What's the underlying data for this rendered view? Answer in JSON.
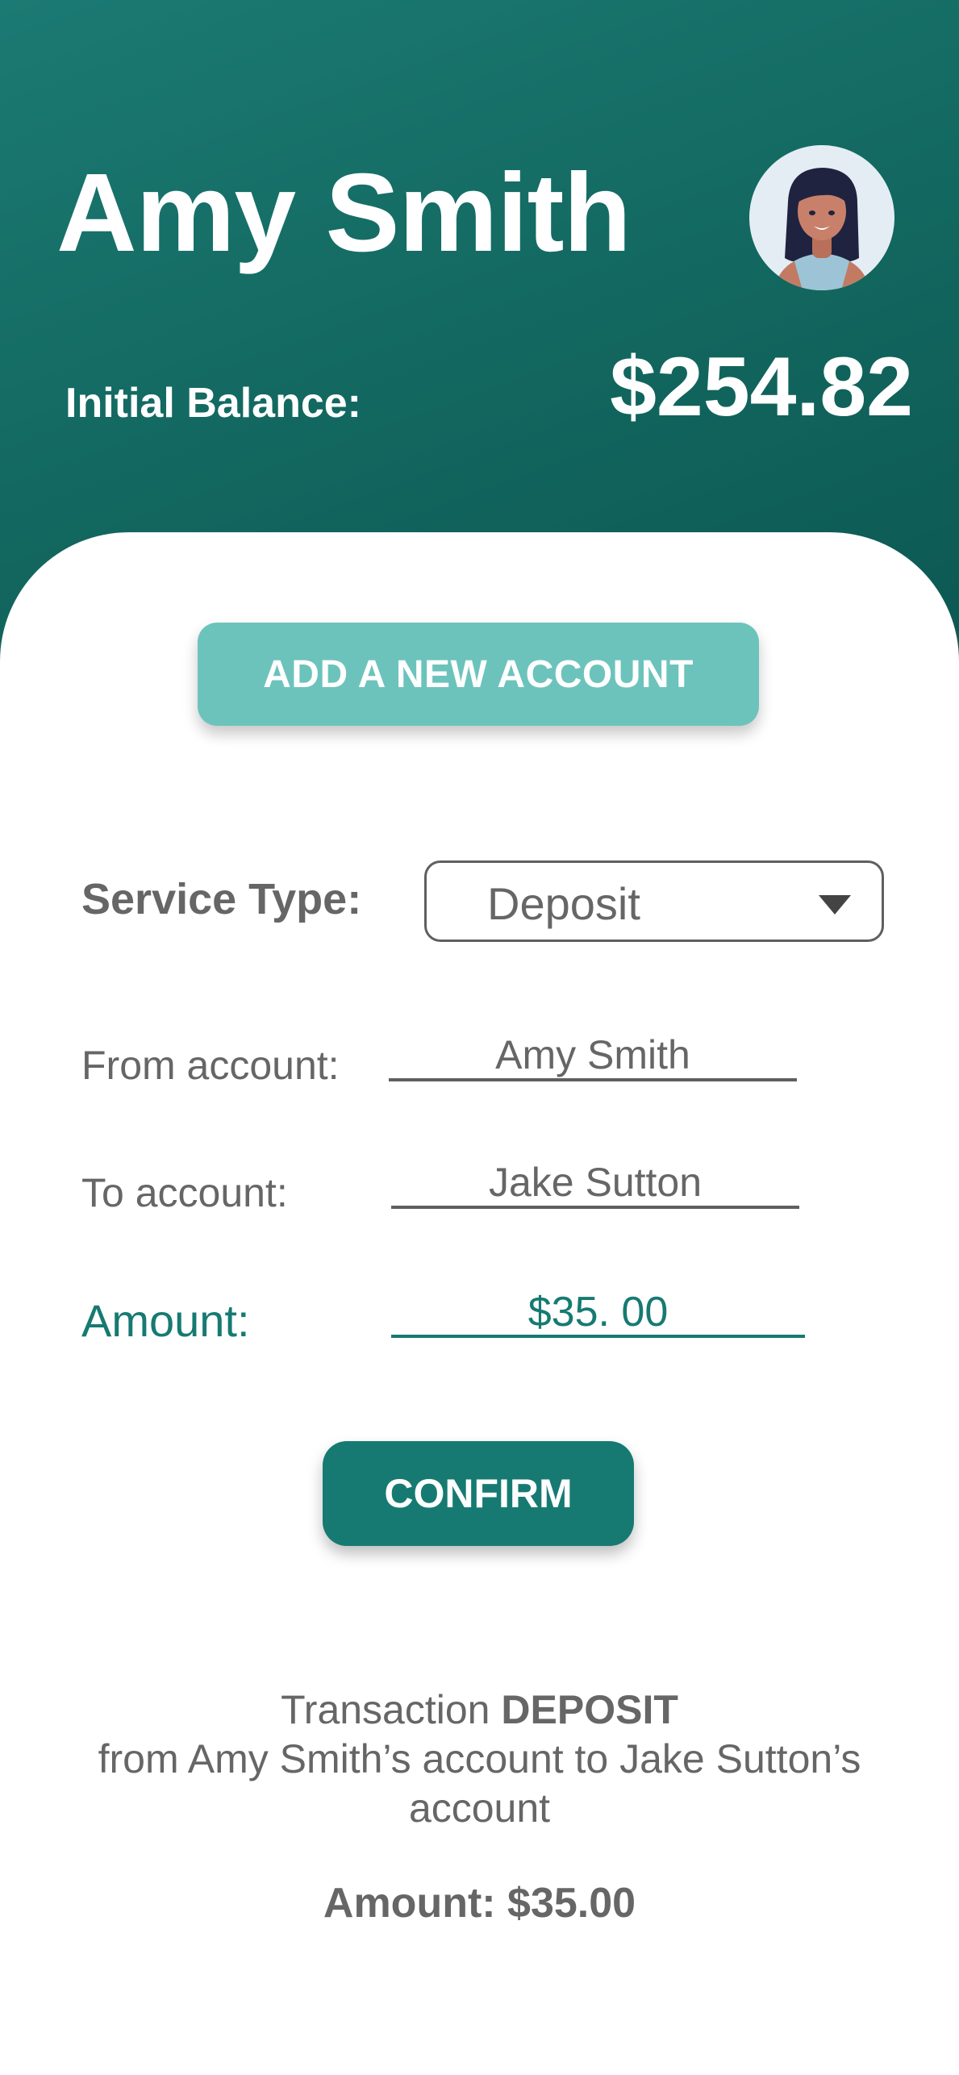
{
  "header": {
    "user_name": "Amy Smith",
    "balance_label": "Initial Balance:",
    "balance_value": "$254.82"
  },
  "actions": {
    "add_account_label": "ADD A NEW ACCOUNT",
    "confirm_label": "CONFIRM"
  },
  "form": {
    "service_type_label": "Service Type:",
    "service_type_value": "Deposit",
    "from_label": "From account:",
    "from_value": "Amy Smith",
    "to_label": "To account:",
    "to_value": "Jake Sutton",
    "amount_label": "Amount:",
    "amount_value": "$35. 00"
  },
  "summary": {
    "prefix": "Transaction ",
    "type": "DEPOSIT",
    "line2": "from Amy Smith’s account to Jake Sutton’s account",
    "amount": "Amount: $35.00"
  },
  "colors": {
    "primary": "#167a72",
    "accent_light": "#6cc3bc",
    "header_dark": "#0c5852"
  },
  "icons": {
    "avatar": "user-avatar-illustration",
    "dropdown": "caret-down-icon"
  }
}
